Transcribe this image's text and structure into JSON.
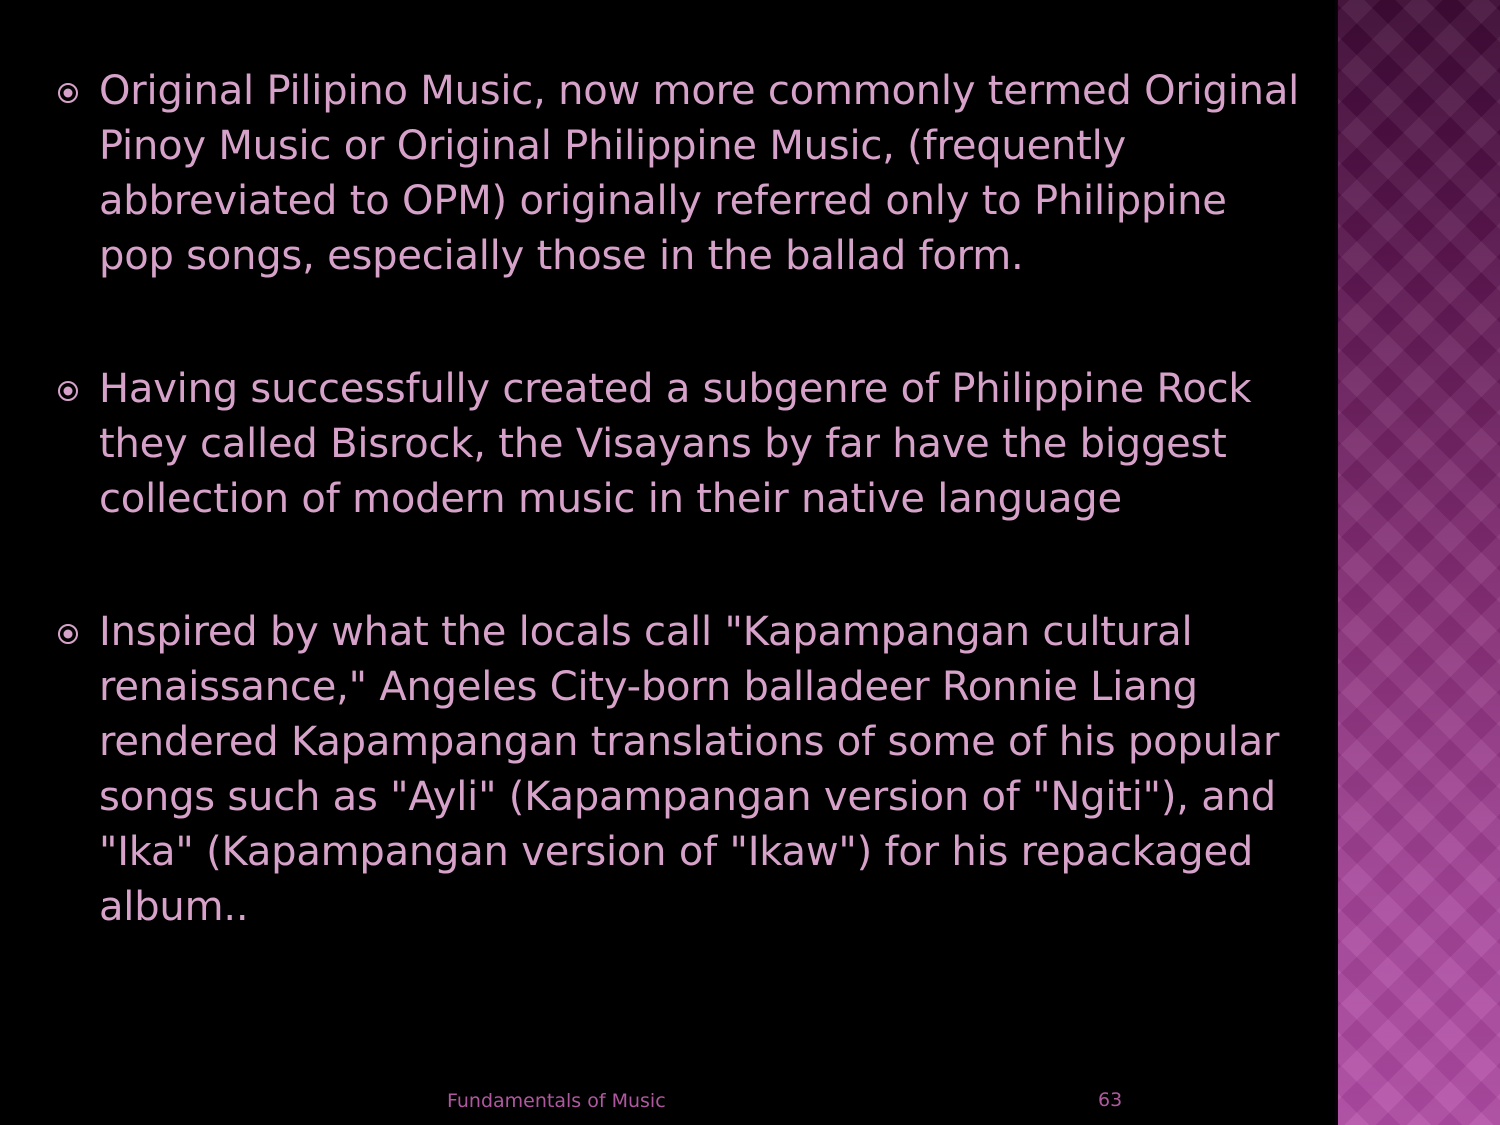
{
  "slide": {
    "bullets": [
      {
        "text": "Original Pilipino Music, now more commonly termed Original Pinoy Music or Original Philippine Music, (frequently abbreviated to OPM) originally referred only to Philippine pop songs, especially those in the ballad form."
      },
      {
        "text": "Having successfully created a subgenre of Philippine Rock they called Bisrock, the Visayans by far have the biggest collection of modern music in their native language"
      },
      {
        "text": "Inspired by what the locals call \"Kapampangan cultural renaissance,\" Angeles City-born balladeer Ronnie Liang rendered Kapampangan translations of some of his popular songs such as \"Ayli\" (Kapampangan version of \"Ngiti\"), and \"Ika\" (Kapampangan version of \"Ikaw\") for his repackaged album.."
      }
    ],
    "bullet_icon": "circled-dot-icon",
    "footer": "Fundamentals of Music",
    "page_number": "63"
  },
  "colors": {
    "background": "#000000",
    "text": "#d6a2c9",
    "bullet": "#d6a2c9",
    "footer": "#b0589f",
    "side_panel_top": "#3e0a35",
    "side_panel_bottom": "#b24ca6"
  }
}
